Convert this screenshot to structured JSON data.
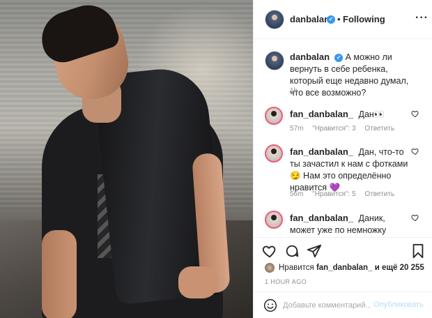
{
  "header": {
    "username": "danbalan",
    "separator": "•",
    "following_label": "Following",
    "more_label": "···"
  },
  "caption": {
    "username": "danbalan",
    "text": "А можно ли вернуть в себе ребенка, который еще недавно думал, что все возможно?",
    "time": "1h"
  },
  "comments": [
    {
      "username": "fan_danbalan_",
      "text": "Дан👀",
      "time": "57m",
      "likes": "\"Нравится\": 3",
      "reply": "Ответить"
    },
    {
      "username": "fan_danbalan_",
      "text": "Дан, что-то ты зачастил к нам с фотками😏 Нам это определённо нравится 💜",
      "time": "56m",
      "likes": "\"Нравится\": 5",
      "reply": "Ответить"
    },
    {
      "username": "fan_danbalan_",
      "text": "Даник, может уже по немножку начнёшь"
    }
  ],
  "likes": {
    "prefix": "Нравится",
    "username": "fan_danbalan_",
    "suffix": "и ещё 20 255"
  },
  "timeago": "1 HOUR AGO",
  "add_comment": {
    "placeholder": "Добавьте комментарий...",
    "publish_label": "Опубликовать"
  },
  "colors": {
    "verified": "#3897f0",
    "publish": "#b2dffc",
    "story_ring": "#ee5a7a"
  }
}
